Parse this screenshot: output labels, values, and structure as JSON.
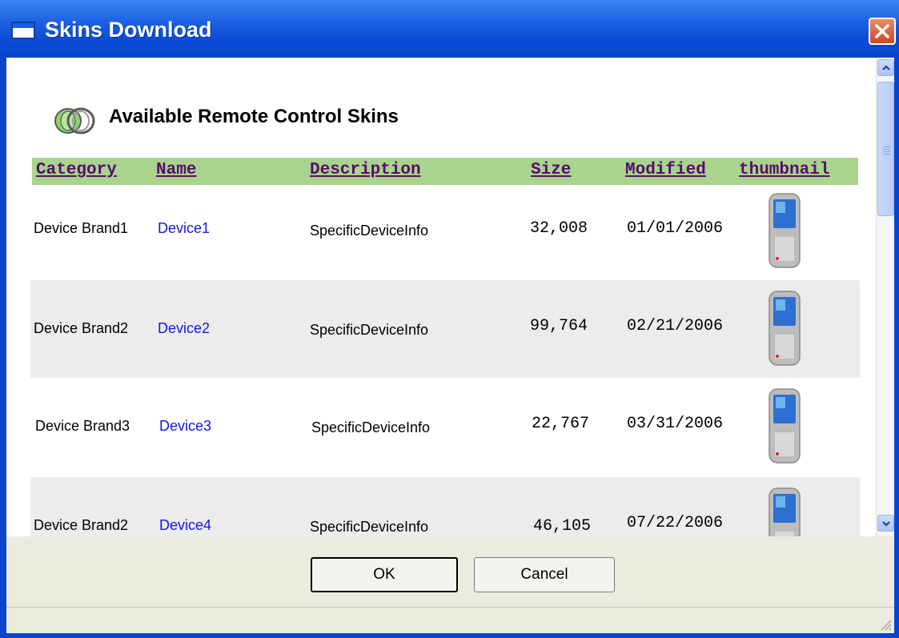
{
  "window": {
    "title": "Skins Download"
  },
  "heading": "Available Remote Control Skins",
  "table": {
    "headers": [
      "Category",
      "Name",
      "Description",
      "Size",
      "Modified",
      "thumbnail"
    ],
    "rows": [
      {
        "category": "Device Brand1",
        "name": "Device1",
        "description": "SpecificDeviceInfo",
        "size": "32,008",
        "modified": "01/01/2006"
      },
      {
        "category": "Device Brand2",
        "name": "Device2",
        "description": "SpecificDeviceInfo",
        "size": "99,764",
        "modified": "02/21/2006"
      },
      {
        "category": "Device Brand3",
        "name": "Device3",
        "description": "SpecificDeviceInfo",
        "size": "22,767",
        "modified": "03/31/2006"
      },
      {
        "category": "Device Brand2",
        "name": "Device4",
        "description": "SpecificDeviceInfo",
        "size": "46,105",
        "modified": "07/22/2006"
      }
    ]
  },
  "buttons": {
    "ok": "OK",
    "cancel": "Cancel"
  },
  "icons": {
    "window": "window-icon",
    "close": "close-icon",
    "heading": "rings-icon",
    "thumbnail": "handheld-device-icon",
    "scroll_up": "chevron-up-icon",
    "scroll_down": "chevron-down-icon",
    "resize": "resize-grip-icon"
  },
  "colors": {
    "title_bar": "#0a4bd6",
    "header_row": "#a8d48e",
    "header_text": "#5a0a6e",
    "link": "#1515e6",
    "row_shade": "#ececec",
    "footer": "#ecebe0"
  }
}
